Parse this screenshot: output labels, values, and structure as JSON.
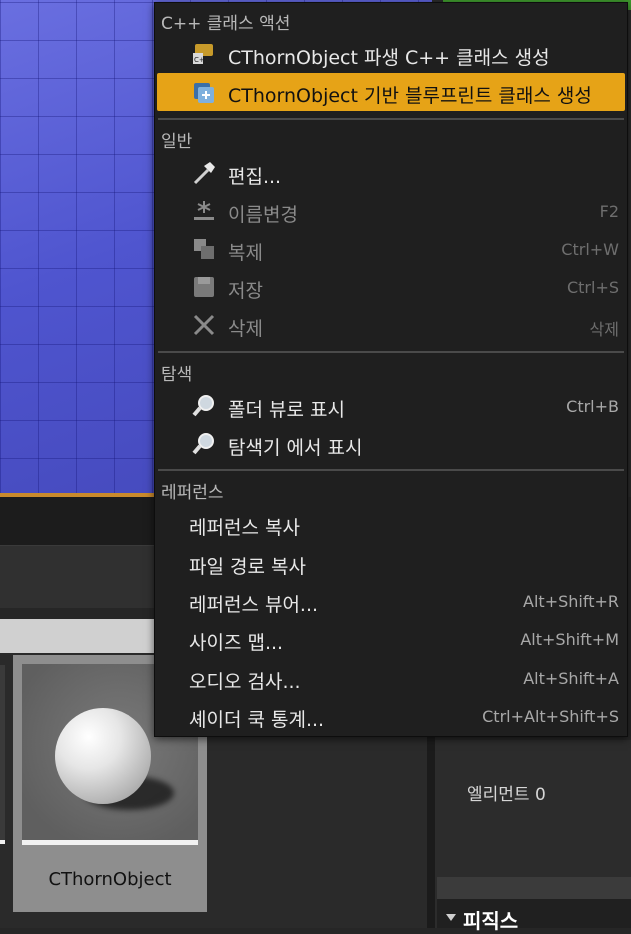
{
  "menu": {
    "cpp_section": {
      "header": "C++ 클래스 액션",
      "items": [
        {
          "label": "CThornObject 파생 C++ 클래스 생성",
          "icon": "cpp-class-icon"
        },
        {
          "label": "CThornObject 기반 블루프린트 클래스 생성",
          "icon": "blueprint-class-icon"
        }
      ]
    },
    "general_section": {
      "header": "일반",
      "items": [
        {
          "label": "편집...",
          "shortcut": "",
          "icon": "hammer-icon"
        },
        {
          "label": "이름변경",
          "shortcut": "F2",
          "icon": "rename-icon"
        },
        {
          "label": "복제",
          "shortcut": "Ctrl+W",
          "icon": "duplicate-icon"
        },
        {
          "label": "저장",
          "shortcut": "Ctrl+S",
          "icon": "save-icon"
        },
        {
          "label": "삭제",
          "shortcut": "삭제",
          "icon": "delete-icon"
        }
      ]
    },
    "browse_section": {
      "header": "탐색",
      "items": [
        {
          "label": "폴더 뷰로 표시",
          "shortcut": "Ctrl+B",
          "icon": "magnifier-icon"
        },
        {
          "label": "탐색기 에서 표시",
          "shortcut": "",
          "icon": "magnifier-icon"
        }
      ]
    },
    "reference_section": {
      "header": "레퍼런스",
      "items": [
        {
          "label": "레퍼런스 복사",
          "shortcut": ""
        },
        {
          "label": "파일 경로 복사",
          "shortcut": ""
        },
        {
          "label": "레퍼런스 뷰어...",
          "shortcut": "Alt+Shift+R"
        },
        {
          "label": "사이즈 맵...",
          "shortcut": "Alt+Shift+M"
        },
        {
          "label": "오디오 검사...",
          "shortcut": "Alt+Shift+A"
        },
        {
          "label": "셰이더 쿡 통계...",
          "shortcut": "Ctrl+Alt+Shift+S"
        }
      ]
    }
  },
  "asset": {
    "name": "CThornObject"
  },
  "details": {
    "element_count": "엘리먼트 0",
    "physics_title": "피직스"
  },
  "colors": {
    "highlight": "#e6a317",
    "menu_bg": "#1f1f1f",
    "viewport_blue": "#5057cf"
  }
}
